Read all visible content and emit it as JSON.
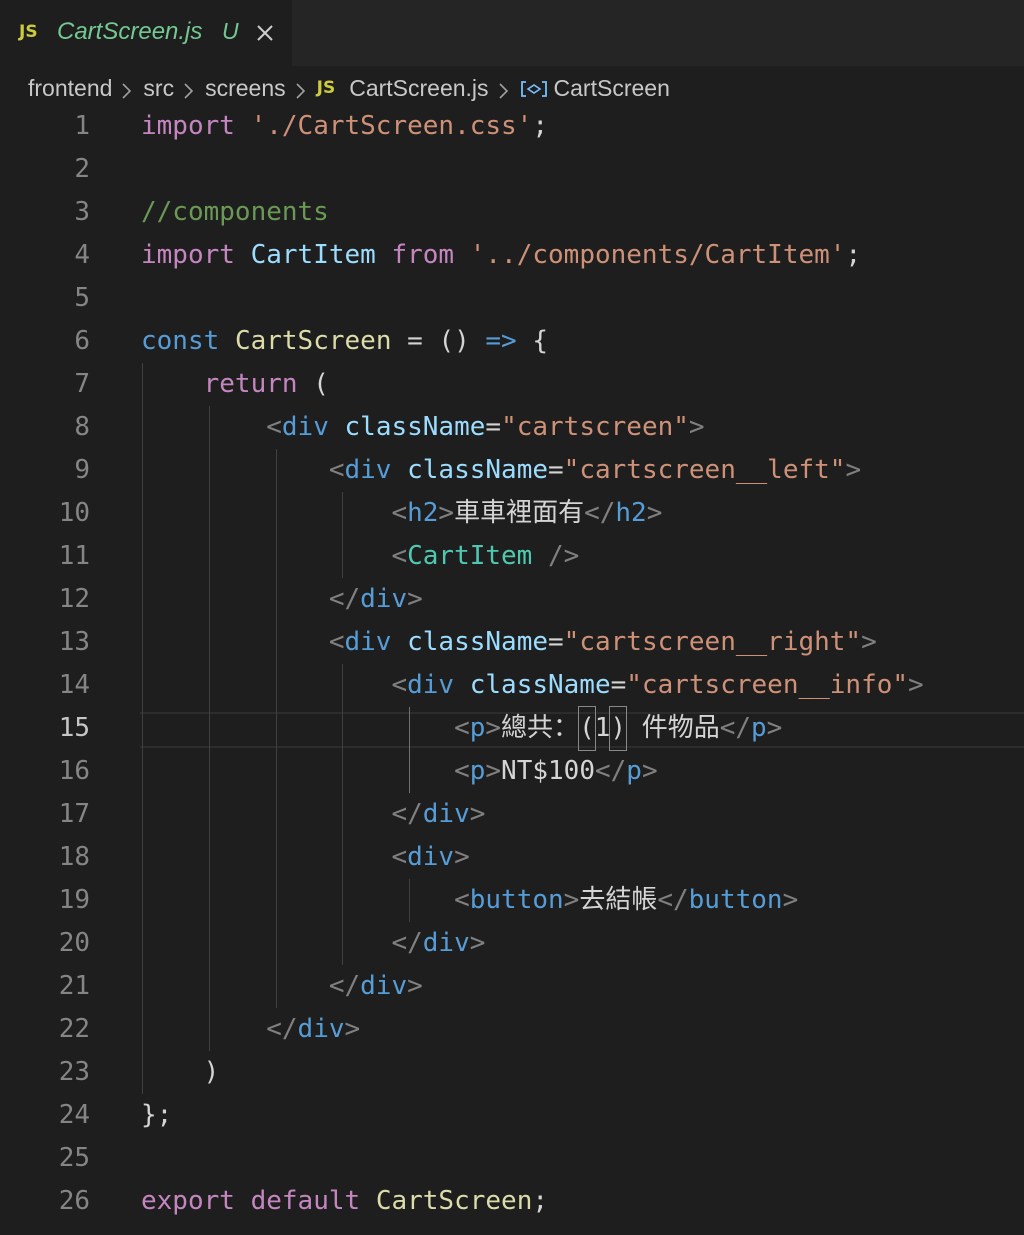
{
  "tab": {
    "badge": "JS",
    "filename": "CartScreen.js",
    "status": "U"
  },
  "breadcrumb": {
    "items": [
      "frontend",
      "src",
      "screens"
    ],
    "file_badge": "JS",
    "file": "CartScreen.js",
    "symbol": "CartScreen"
  },
  "editor": {
    "active_line": 15,
    "lines": [
      {
        "n": "1",
        "tokens": [
          {
            "c": "kw",
            "t": "import"
          },
          {
            "c": "txt",
            "t": " "
          },
          {
            "c": "str",
            "t": "'./CartScreen.css'"
          },
          {
            "c": "txt",
            "t": ";"
          }
        ]
      },
      {
        "n": "2",
        "tokens": []
      },
      {
        "n": "3",
        "tokens": [
          {
            "c": "cm",
            "t": "//components"
          }
        ]
      },
      {
        "n": "4",
        "tokens": [
          {
            "c": "kw",
            "t": "import"
          },
          {
            "c": "txt",
            "t": " "
          },
          {
            "c": "attr",
            "t": "CartItem"
          },
          {
            "c": "txt",
            "t": " "
          },
          {
            "c": "kw",
            "t": "from"
          },
          {
            "c": "txt",
            "t": " "
          },
          {
            "c": "str",
            "t": "'../components/CartItem'"
          },
          {
            "c": "txt",
            "t": ";"
          }
        ]
      },
      {
        "n": "5",
        "tokens": []
      },
      {
        "n": "6",
        "tokens": [
          {
            "c": "st",
            "t": "const"
          },
          {
            "c": "txt",
            "t": " "
          },
          {
            "c": "fn",
            "t": "CartScreen"
          },
          {
            "c": "txt",
            "t": " = () "
          },
          {
            "c": "ar",
            "t": "=>"
          },
          {
            "c": "txt",
            "t": " {"
          }
        ]
      },
      {
        "n": "7",
        "tokens": [
          {
            "c": "txt",
            "t": "    "
          },
          {
            "c": "kw",
            "t": "return"
          },
          {
            "c": "txt",
            "t": " ("
          }
        ]
      },
      {
        "n": "8",
        "tokens": [
          {
            "c": "txt",
            "t": "        "
          },
          {
            "c": "pun",
            "t": "<"
          },
          {
            "c": "tg",
            "t": "div"
          },
          {
            "c": "txt",
            "t": " "
          },
          {
            "c": "attr",
            "t": "className"
          },
          {
            "c": "txt",
            "t": "="
          },
          {
            "c": "str",
            "t": "\"cartscreen\""
          },
          {
            "c": "pun",
            "t": ">"
          }
        ]
      },
      {
        "n": "9",
        "tokens": [
          {
            "c": "txt",
            "t": "            "
          },
          {
            "c": "pun",
            "t": "<"
          },
          {
            "c": "tg",
            "t": "div"
          },
          {
            "c": "txt",
            "t": " "
          },
          {
            "c": "attr",
            "t": "className"
          },
          {
            "c": "txt",
            "t": "="
          },
          {
            "c": "str",
            "t": "\"cartscreen__left\""
          },
          {
            "c": "pun",
            "t": ">"
          }
        ]
      },
      {
        "n": "10",
        "tokens": [
          {
            "c": "txt",
            "t": "                "
          },
          {
            "c": "pun",
            "t": "<"
          },
          {
            "c": "tg",
            "t": "h2"
          },
          {
            "c": "pun",
            "t": ">"
          },
          {
            "c": "txt cjk",
            "t": "車車裡面有"
          },
          {
            "c": "pun",
            "t": "</"
          },
          {
            "c": "tg",
            "t": "h2"
          },
          {
            "c": "pun",
            "t": ">"
          }
        ]
      },
      {
        "n": "11",
        "tokens": [
          {
            "c": "txt",
            "t": "                "
          },
          {
            "c": "pun",
            "t": "<"
          },
          {
            "c": "cls",
            "t": "CartItem"
          },
          {
            "c": "txt",
            "t": " "
          },
          {
            "c": "pun",
            "t": "/>"
          }
        ]
      },
      {
        "n": "12",
        "tokens": [
          {
            "c": "txt",
            "t": "            "
          },
          {
            "c": "pun",
            "t": "</"
          },
          {
            "c": "tg",
            "t": "div"
          },
          {
            "c": "pun",
            "t": ">"
          }
        ]
      },
      {
        "n": "13",
        "tokens": [
          {
            "c": "txt",
            "t": "            "
          },
          {
            "c": "pun",
            "t": "<"
          },
          {
            "c": "tg",
            "t": "div"
          },
          {
            "c": "txt",
            "t": " "
          },
          {
            "c": "attr",
            "t": "className"
          },
          {
            "c": "txt",
            "t": "="
          },
          {
            "c": "str",
            "t": "\"cartscreen__right\""
          },
          {
            "c": "pun",
            "t": ">"
          }
        ]
      },
      {
        "n": "14",
        "tokens": [
          {
            "c": "txt",
            "t": "                "
          },
          {
            "c": "pun",
            "t": "<"
          },
          {
            "c": "tg",
            "t": "div"
          },
          {
            "c": "txt",
            "t": " "
          },
          {
            "c": "attr",
            "t": "className"
          },
          {
            "c": "txt",
            "t": "="
          },
          {
            "c": "str",
            "t": "\"cartscreen__info\""
          },
          {
            "c": "pun",
            "t": ">"
          }
        ]
      },
      {
        "n": "15",
        "tokens": [
          {
            "c": "txt",
            "t": "                    "
          },
          {
            "c": "pun",
            "t": "<"
          },
          {
            "c": "tg",
            "t": "p"
          },
          {
            "c": "pun",
            "t": ">"
          },
          {
            "c": "txt cjk",
            "t": "總共："
          },
          {
            "c": "txt box",
            "t": "("
          },
          {
            "c": "txt",
            "t": "1"
          },
          {
            "c": "txt box",
            "t": ")"
          },
          {
            "c": "txt",
            "t": " "
          },
          {
            "c": "txt cjk",
            "t": "件物品"
          },
          {
            "c": "pun",
            "t": "</"
          },
          {
            "c": "tg",
            "t": "p"
          },
          {
            "c": "pun",
            "t": ">"
          }
        ]
      },
      {
        "n": "16",
        "tokens": [
          {
            "c": "txt",
            "t": "                    "
          },
          {
            "c": "pun",
            "t": "<"
          },
          {
            "c": "tg",
            "t": "p"
          },
          {
            "c": "pun",
            "t": ">"
          },
          {
            "c": "txt",
            "t": "NT$100"
          },
          {
            "c": "pun",
            "t": "</"
          },
          {
            "c": "tg",
            "t": "p"
          },
          {
            "c": "pun",
            "t": ">"
          }
        ]
      },
      {
        "n": "17",
        "tokens": [
          {
            "c": "txt",
            "t": "                "
          },
          {
            "c": "pun",
            "t": "</"
          },
          {
            "c": "tg",
            "t": "div"
          },
          {
            "c": "pun",
            "t": ">"
          }
        ]
      },
      {
        "n": "18",
        "tokens": [
          {
            "c": "txt",
            "t": "                "
          },
          {
            "c": "pun",
            "t": "<"
          },
          {
            "c": "tg",
            "t": "div"
          },
          {
            "c": "pun",
            "t": ">"
          }
        ]
      },
      {
        "n": "19",
        "tokens": [
          {
            "c": "txt",
            "t": "                    "
          },
          {
            "c": "pun",
            "t": "<"
          },
          {
            "c": "tg",
            "t": "button"
          },
          {
            "c": "pun",
            "t": ">"
          },
          {
            "c": "txt cjk",
            "t": "去結帳"
          },
          {
            "c": "pun",
            "t": "</"
          },
          {
            "c": "tg",
            "t": "button"
          },
          {
            "c": "pun",
            "t": ">"
          }
        ]
      },
      {
        "n": "20",
        "tokens": [
          {
            "c": "txt",
            "t": "                "
          },
          {
            "c": "pun",
            "t": "</"
          },
          {
            "c": "tg",
            "t": "div"
          },
          {
            "c": "pun",
            "t": ">"
          }
        ]
      },
      {
        "n": "21",
        "tokens": [
          {
            "c": "txt",
            "t": "            "
          },
          {
            "c": "pun",
            "t": "</"
          },
          {
            "c": "tg",
            "t": "div"
          },
          {
            "c": "pun",
            "t": ">"
          }
        ]
      },
      {
        "n": "22",
        "tokens": [
          {
            "c": "txt",
            "t": "        "
          },
          {
            "c": "pun",
            "t": "</"
          },
          {
            "c": "tg",
            "t": "div"
          },
          {
            "c": "pun",
            "t": ">"
          }
        ]
      },
      {
        "n": "23",
        "tokens": [
          {
            "c": "txt",
            "t": "    )"
          }
        ]
      },
      {
        "n": "24",
        "tokens": [
          {
            "c": "txt",
            "t": "};"
          }
        ]
      },
      {
        "n": "25",
        "tokens": []
      },
      {
        "n": "26",
        "tokens": [
          {
            "c": "kw",
            "t": "export"
          },
          {
            "c": "txt",
            "t": " "
          },
          {
            "c": "kw",
            "t": "default"
          },
          {
            "c": "txt",
            "t": " "
          },
          {
            "c": "fn",
            "t": "CartScreen"
          },
          {
            "c": "txt",
            "t": ";"
          }
        ]
      }
    ]
  },
  "colors": {
    "background": "#1e1e1e",
    "tabbar": "#252526",
    "js_badge": "#cbcb41",
    "untracked": "#73c991",
    "keyword": "#c586c0",
    "string": "#ce9178",
    "comment": "#6a9955",
    "component": "#4ec9b0",
    "function": "#dcdcaa",
    "tag": "#569cd6",
    "attribute": "#9cdcfe",
    "punctuation": "#808080"
  },
  "icons": {
    "tab_close": "close-icon",
    "breadcrumb_separator": "chevron-right-icon",
    "symbol": "symbol-variable-icon"
  }
}
